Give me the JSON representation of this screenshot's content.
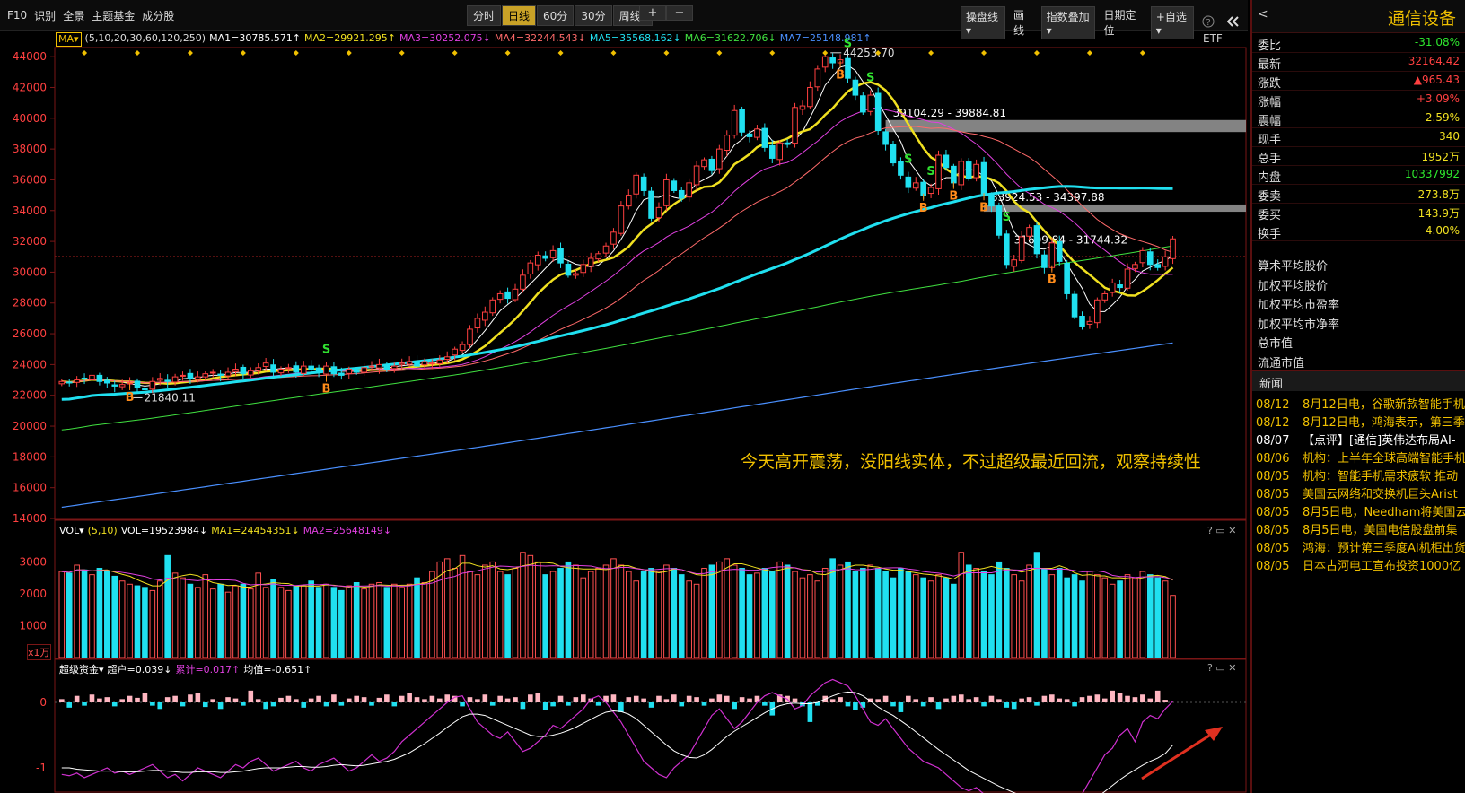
{
  "toolbar": {
    "menu": [
      "F10",
      "识别",
      "全景",
      "主题基金",
      "成分股"
    ],
    "period_tabs": [
      "分时",
      "日线",
      "60分",
      "30分",
      "周线▾"
    ],
    "active_period": "日线",
    "zoom": [
      "+",
      "−"
    ],
    "right_tools": [
      "操盘线▾",
      "画线",
      "指数叠加▾",
      "日期定位",
      "+自选▾"
    ],
    "icons": [
      "help-icon",
      "collapse-icon"
    ]
  },
  "ma_legend": {
    "prefix": "MA▾",
    "periods_label": "(5,10,20,30,60,120,250)",
    "items": [
      {
        "text": "MA1=30785.571↑",
        "color": "#ffffff"
      },
      {
        "text": "MA2=29921.295↑",
        "color": "#f0e020"
      },
      {
        "text": "MA3=30252.075↓",
        "color": "#e040e0"
      },
      {
        "text": "MA4=32244.543↓",
        "color": "#ff6a6a"
      },
      {
        "text": "MA5=35568.162↓",
        "color": "#20e0f0"
      },
      {
        "text": "MA6=31622.706↓",
        "color": "#40e040"
      },
      {
        "text": "MA7=25148.981↑",
        "color": "#4a90ff"
      }
    ],
    "etf": "ETF"
  },
  "vol_legend": {
    "prefix": "VOL▾",
    "params": "(5,10)",
    "items": [
      {
        "text": "VOL=19523984↓",
        "color": "#ffffff"
      },
      {
        "text": "MA1=24454351↓",
        "color": "#f0e020"
      },
      {
        "text": "MA2=25648149↓",
        "color": "#e040e0"
      }
    ],
    "unit": "x1万"
  },
  "fund_legend": {
    "prefix": "超级资金▾",
    "items": [
      {
        "text": "超户=0.039↓",
        "color": "#ffffff"
      },
      {
        "text": "累计=0.017↑",
        "color": "#e040e0"
      },
      {
        "text": "均值=-0.651↑",
        "color": "#ffffff"
      }
    ]
  },
  "panel_controls": "? ▭ ✕",
  "annotation": "今天高开震荡，没阳线实体，不过超级最近回流，观察持续性",
  "price_labels": {
    "high": "44253.70",
    "low": "21840.11",
    "zone1": "39104.29 - 39884.81",
    "zone2": "33924.53 - 34397.88",
    "zone3": "31609.84 - 31744.32"
  },
  "signals": {
    "buy": "B",
    "sell": "S"
  },
  "sidebar": {
    "back": "<",
    "name": "通信设备",
    "rows": [
      {
        "k": "委比",
        "v": "-31.08%",
        "color": "#2ee82e"
      },
      {
        "k": "最新",
        "v": "32164.42",
        "color": "#ff4040"
      },
      {
        "k": "涨跌",
        "v": "▲965.43",
        "color": "#ff4040"
      },
      {
        "k": "涨幅",
        "v": "+3.09%",
        "color": "#ff4040"
      },
      {
        "k": "震幅",
        "v": "2.59%",
        "color": "#f0e020"
      },
      {
        "k": "现手",
        "v": "340",
        "color": "#f0e020"
      },
      {
        "k": "总手",
        "v": "1952万",
        "color": "#f0e020"
      },
      {
        "k": "内盘",
        "v": "10337992",
        "color": "#2ee82e"
      },
      {
        "k": "委卖",
        "v": "273.8万",
        "color": "#f0e020"
      },
      {
        "k": "委买",
        "v": "143.9万",
        "color": "#f0e020"
      },
      {
        "k": "换手",
        "v": "4.00%",
        "color": "#f0e020"
      }
    ],
    "plain": [
      "算术平均股价",
      "加权平均股价",
      "加权平均市盈率",
      "加权平均市净率",
      "总市值",
      "流通市值"
    ],
    "news_title": "新闻",
    "news": [
      {
        "d": "08/12",
        "t": "8月12日电，谷歌新款智能手机",
        "color": "#f0c000"
      },
      {
        "d": "08/12",
        "t": "8月12日电，鸿海表示，第三季",
        "color": "#f0c000"
      },
      {
        "d": "08/07",
        "t": "【点评】[通信]英伟达布局AI-",
        "color": "#ffffff"
      },
      {
        "d": "08/06",
        "t": "机构：上半年全球高端智能手机",
        "color": "#f0c000"
      },
      {
        "d": "08/05",
        "t": "机构：智能手机需求疲软 推动",
        "color": "#f0c000"
      },
      {
        "d": "08/05",
        "t": "美国云网络和交换机巨头Arist",
        "color": "#f0c000"
      },
      {
        "d": "08/05",
        "t": "8月5日电，Needham将美国云",
        "color": "#f0c000"
      },
      {
        "d": "08/05",
        "t": "8月5日电，美国电信股盘前集",
        "color": "#f0c000"
      },
      {
        "d": "08/05",
        "t": "鸿海：预计第三季度AI机柜出货",
        "color": "#f0c000"
      },
      {
        "d": "08/05",
        "t": "日本古河电工宣布投资1000亿",
        "color": "#f0c000"
      }
    ]
  },
  "chart_data": [
    {
      "type": "candlestick",
      "title": "",
      "ylim": [
        14000,
        45000
      ],
      "yticks": [
        "44000",
        "42000",
        "40000",
        "38000",
        "36000",
        "34000",
        "32000",
        "30000",
        "28000",
        "26000",
        "24000",
        "22000",
        "20000",
        "18000",
        "16000",
        "14000"
      ],
      "closes": [
        22900,
        22800,
        23000,
        23100,
        23300,
        22900,
        22800,
        22600,
        22700,
        22800,
        22500,
        22400,
        22900,
        23100,
        22900,
        23200,
        23300,
        23100,
        23200,
        23400,
        23500,
        23300,
        23500,
        23700,
        23400,
        23600,
        23800,
        24100,
        23500,
        23700,
        23800,
        23500,
        23900,
        23700,
        23500,
        23900,
        23400,
        23300,
        23700,
        23500,
        23800,
        23900,
        24000,
        23700,
        23900,
        24100,
        24200,
        23900,
        24200,
        24100,
        24300,
        24500,
        25000,
        25300,
        26300,
        27000,
        27400,
        28200,
        28600,
        28300,
        28900,
        29800,
        30600,
        31100,
        30900,
        31400,
        30600,
        29800,
        29900,
        30500,
        30900,
        31200,
        31700,
        32600,
        34300,
        35000,
        36300,
        35300,
        33500,
        34200,
        36000,
        35300,
        34800,
        35800,
        36900,
        37300,
        36600,
        38000,
        38900,
        40500,
        39100,
        38800,
        39300,
        38100,
        37400,
        38400,
        38300,
        40700,
        40800,
        42000,
        43200,
        44000,
        43600,
        43800,
        42600,
        41500,
        40400,
        41500,
        39200,
        38300,
        37100,
        36300,
        35500,
        35800,
        35000,
        35500,
        37600,
        36800,
        35800,
        37200,
        36100,
        37000,
        35100,
        34300,
        32400,
        30500,
        30800,
        32300,
        32900,
        31200,
        30300,
        31900,
        30700,
        28600,
        27100,
        26500,
        26800,
        28200,
        28600,
        29300,
        29000,
        30200,
        30500,
        31400,
        30500,
        30300,
        31000,
        32164
      ],
      "ma_series": [
        "MA1",
        "MA2",
        "MA3",
        "MA4",
        "MA5",
        "MA6",
        "MA7"
      ],
      "ma_last": [
        30785.571,
        29921.295,
        30252.075,
        32244.543,
        35568.162,
        31622.706,
        25148.981
      ]
    },
    {
      "type": "bar",
      "title": "VOL",
      "unit": "x1万",
      "ylim": [
        0,
        3800
      ],
      "yticks": [
        "3000",
        "2000",
        "1000"
      ],
      "values": [
        2700,
        2650,
        2900,
        2750,
        2600,
        2800,
        2700,
        2550,
        2400,
        2300,
        2250,
        2200,
        2100,
        2400,
        3200,
        2650,
        2500,
        2300,
        2200,
        2600,
        2150,
        2300,
        2050,
        2250,
        2300,
        2150,
        2650,
        2200,
        2450,
        2200,
        2100,
        2250,
        2250,
        2400,
        2200,
        2300,
        2200,
        2100,
        2250,
        2350,
        2150,
        2300,
        2350,
        2200,
        2300,
        2200,
        2300,
        2500,
        2350,
        2700,
        3000,
        3100,
        2800,
        3200,
        2700,
        2600,
        2900,
        3000,
        2700,
        2600,
        2800,
        3300,
        3200,
        3000,
        2600,
        2700,
        2800,
        3000,
        2900,
        2500,
        2700,
        2800,
        2900,
        3100,
        2900,
        2700,
        2400,
        2700,
        2800,
        2700,
        2900,
        2800,
        2600,
        2400,
        2300,
        2800,
        2900,
        3000,
        3100,
        2900,
        2800,
        2600,
        2650,
        2800,
        2700,
        3000,
        2900,
        2700,
        2500,
        2600,
        2400,
        2800,
        3100,
        2900,
        3000,
        2700,
        2800,
        2900,
        2800,
        2700,
        2500,
        2800,
        2700,
        2600,
        2500,
        2400,
        2600,
        2500,
        2300,
        3300,
        2900,
        2800,
        2700,
        2600,
        3000,
        2800,
        2600,
        2400,
        2900,
        3300,
        2800,
        2600,
        2800,
        2500,
        2600,
        2400,
        2700,
        2600,
        2500,
        2300,
        2400,
        2600,
        2500,
        2700,
        2600,
        2500,
        2400,
        1950
      ]
    },
    {
      "type": "bar",
      "title": "超级资金",
      "ylim": [
        -1.75,
        0.4
      ],
      "yticks": [
        "0",
        "-1"
      ],
      "values": [
        0.05,
        -0.08,
        0.1,
        -0.05,
        0.12,
        0.06,
        0.08,
        -0.06,
        0.05,
        0.1,
        0.07,
        0.15,
        -0.05,
        -0.1,
        0.08,
        0.1,
        -0.06,
        0.12,
        0.15,
        -0.07,
        0.05,
        -0.1,
        0.08,
        0.06,
        -0.05,
        0.18,
        0.05,
        -0.1,
        -0.06,
        0.07,
        0.1,
        0.05,
        -0.08,
        0.06,
        0.1,
        -0.06,
        0.12,
        -0.05,
        0.06,
        0.1,
        0.08,
        -0.05,
        0.07,
        0.12,
        -0.06,
        0.1,
        0.15,
        0.08,
        0.05,
        0.1,
        0.06,
        0.12,
        0.1,
        -0.06,
        0.08,
        0.05,
        0.12,
        -0.05,
        0.1,
        0.06,
        0.08,
        -0.1,
        0.12,
        0.15,
        -0.12,
        -0.06,
        0.1,
        -0.05,
        0.08,
        0.12,
        0.06,
        -0.05,
        0.1,
        0.12,
        -0.15,
        0.08,
        0.1,
        0.06,
        -0.08,
        0.1,
        0.05,
        0.12,
        -0.06,
        0.1,
        0.08,
        -0.05,
        0.06,
        0.12,
        0.1,
        -0.1,
        0.08,
        0.06,
        0.1,
        -0.05,
        -0.2,
        0.12,
        0.1,
        0.06,
        -0.06,
        -0.3,
        -0.05,
        0.1,
        0.05,
        0.08,
        -0.06,
        -0.12,
        -0.08,
        0.06,
        0.05,
        0.1,
        -0.06,
        -0.15,
        0.1,
        0.05,
        -0.06,
        0.08,
        -0.1,
        0.06,
        0.1,
        0.12,
        0.05,
        0.08,
        -0.06,
        0.1,
        0.05,
        -0.08,
        -0.1,
        0.06,
        0.08,
        -0.05,
        0.1,
        0.12,
        0.06,
        0.05,
        -0.06,
        0.08,
        0.1,
        0.12,
        0.06,
        0.18,
        0.15,
        0.1,
        0.08,
        0.12,
        0.06,
        0.18,
        0.04
      ],
      "cumulative": [
        -1.1,
        -1.12,
        -1.08,
        -1.15,
        -1.1,
        -1.05,
        -1.0,
        -1.08,
        -1.05,
        -1.1,
        -1.05,
        -1.0,
        -0.95,
        -1.05,
        -1.15,
        -1.1,
        -1.2,
        -1.1,
        -1.0,
        -1.05,
        -1.1,
        -1.15,
        -1.05,
        -0.95,
        -1.0,
        -0.9,
        -0.85,
        -0.95,
        -1.05,
        -1.0,
        -0.95,
        -0.9,
        -1.0,
        -1.05,
        -0.95,
        -0.9,
        -0.85,
        -0.95,
        -1.05,
        -1.0,
        -0.9,
        -0.8,
        -0.9,
        -0.85,
        -0.75,
        -0.6,
        -0.5,
        -0.4,
        -0.3,
        -0.2,
        -0.1,
        0.0,
        0.08,
        0.1,
        -0.1,
        -0.3,
        -0.4,
        -0.5,
        -0.55,
        -0.45,
        -0.6,
        -0.75,
        -0.7,
        -0.6,
        -0.5,
        -0.35,
        -0.4,
        -0.3,
        -0.2,
        -0.1,
        0.05,
        0.1,
        0.0,
        -0.15,
        -0.3,
        -0.5,
        -0.7,
        -0.9,
        -1.0,
        -1.1,
        -1.15,
        -1.0,
        -0.9,
        -0.8,
        -0.6,
        -0.4,
        -0.2,
        -0.1,
        -0.25,
        -0.4,
        -0.3,
        -0.15,
        0.0,
        0.1,
        0.15,
        0.1,
        0.05,
        -0.1,
        -0.05,
        0.1,
        0.2,
        0.3,
        0.35,
        0.3,
        0.25,
        0.1,
        -0.1,
        -0.3,
        -0.35,
        -0.25,
        -0.4,
        -0.55,
        -0.7,
        -0.8,
        -0.9,
        -0.95,
        -1.0,
        -1.1,
        -1.2,
        -1.3,
        -1.35,
        -1.3,
        -1.4,
        -1.5,
        -1.55,
        -1.5,
        -1.45,
        -1.5,
        -1.6,
        -1.65,
        -1.6,
        -1.55,
        -1.6,
        -1.65,
        -1.6,
        -1.4,
        -1.2,
        -1.0,
        -0.8,
        -0.7,
        -0.5,
        -0.4,
        -0.6,
        -0.3,
        -0.2,
        -0.25,
        -0.1,
        0.017
      ],
      "average": [
        -1.0,
        -1.0,
        -1.02,
        -1.03,
        -1.04,
        -1.05,
        -1.05,
        -1.05,
        -1.06,
        -1.06,
        -1.06,
        -1.05,
        -1.04,
        -1.04,
        -1.05,
        -1.06,
        -1.07,
        -1.07,
        -1.06,
        -1.06,
        -1.06,
        -1.07,
        -1.07,
        -1.06,
        -1.05,
        -1.03,
        -1.01,
        -1.0,
        -1.0,
        -1.0,
        -0.99,
        -0.98,
        -0.98,
        -0.99,
        -0.99,
        -0.98,
        -0.96,
        -0.95,
        -0.96,
        -0.97,
        -0.96,
        -0.94,
        -0.92,
        -0.9,
        -0.87,
        -0.82,
        -0.77,
        -0.7,
        -0.63,
        -0.55,
        -0.47,
        -0.38,
        -0.3,
        -0.22,
        -0.18,
        -0.18,
        -0.2,
        -0.25,
        -0.3,
        -0.35,
        -0.4,
        -0.45,
        -0.5,
        -0.52,
        -0.52,
        -0.5,
        -0.47,
        -0.43,
        -0.38,
        -0.32,
        -0.26,
        -0.2,
        -0.15,
        -0.13,
        -0.14,
        -0.18,
        -0.25,
        -0.35,
        -0.45,
        -0.55,
        -0.65,
        -0.74,
        -0.8,
        -0.84,
        -0.85,
        -0.8,
        -0.72,
        -0.62,
        -0.52,
        -0.44,
        -0.37,
        -0.3,
        -0.23,
        -0.16,
        -0.1,
        -0.05,
        -0.02,
        -0.01,
        -0.02,
        -0.02,
        0.0,
        0.05,
        0.1,
        0.14,
        0.16,
        0.15,
        0.1,
        0.02,
        -0.07,
        -0.14,
        -0.2,
        -0.28,
        -0.36,
        -0.45,
        -0.54,
        -0.63,
        -0.72,
        -0.8,
        -0.88,
        -0.96,
        -1.04,
        -1.1,
        -1.16,
        -1.22,
        -1.28,
        -1.33,
        -1.38,
        -1.42,
        -1.46,
        -1.5,
        -1.53,
        -1.55,
        -1.57,
        -1.59,
        -1.6,
        -1.58,
        -1.53,
        -1.45,
        -1.36,
        -1.27,
        -1.18,
        -1.1,
        -1.03,
        -0.96,
        -0.9,
        -0.85,
        -0.78,
        -0.651
      ]
    }
  ]
}
